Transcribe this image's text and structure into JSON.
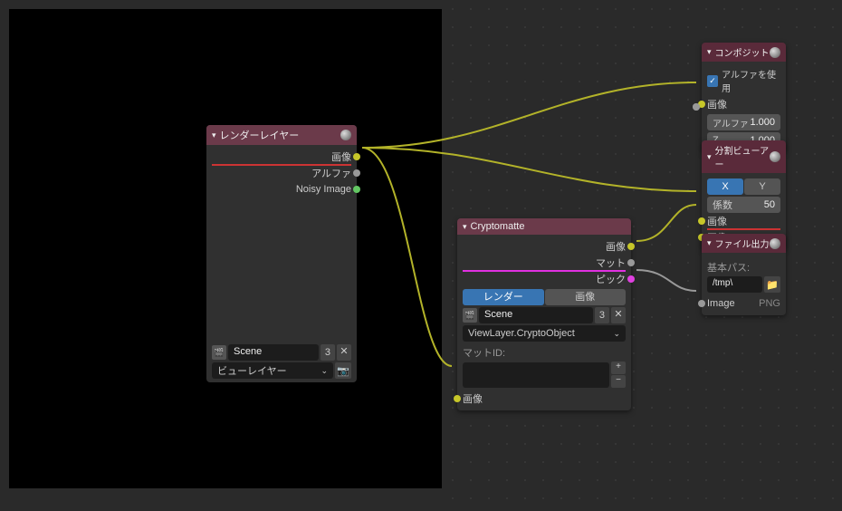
{
  "render_layers": {
    "title": "レンダーレイヤー",
    "outputs": {
      "image": "画像",
      "alpha": "アルファ",
      "noisy": "Noisy Image"
    },
    "scene_name": "Scene",
    "scene_users": "3",
    "viewlayer": "ビューレイヤー"
  },
  "cryptomatte": {
    "title": "Cryptomatte",
    "outputs": {
      "image": "画像",
      "matte": "マット",
      "pick": "ピック"
    },
    "source_tabs": {
      "render": "レンダー",
      "image": "画像"
    },
    "scene_name": "Scene",
    "scene_users": "3",
    "layer": "ViewLayer.CryptoObject",
    "matte_id_label": "マットID:",
    "input_image": "画像"
  },
  "composite": {
    "title": "コンポジット",
    "use_alpha": "アルファを使用",
    "image": "画像",
    "alpha_label": "アルファ",
    "alpha_val": "1.000",
    "z_label": "Z",
    "z_val": "1.000"
  },
  "split_viewer": {
    "title": "分割ビューアー",
    "x": "X",
    "y": "Y",
    "ratio_label": "係数",
    "ratio_val": "50",
    "image1": "画像",
    "image2": "画像"
  },
  "file_output": {
    "title": "ファイル出力",
    "base_path_label": "基本パス:",
    "path": "/tmp\\",
    "input_image": "Image",
    "format": "PNG"
  }
}
